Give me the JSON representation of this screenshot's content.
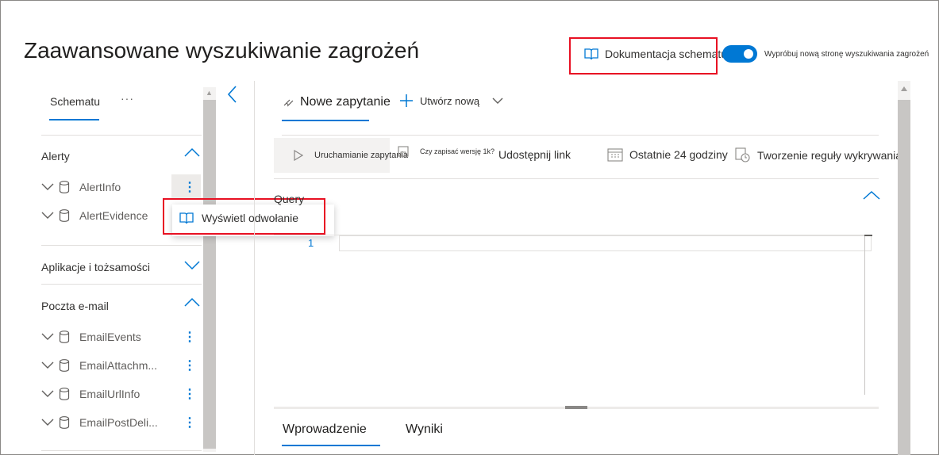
{
  "header": {
    "title": "Zaawansowane wyszukiwanie zagrożeń",
    "doc_link": "Dokumentacja schematu",
    "toggle_label": "Wypróbuj nową stronę wyszukiwania zagrożeń",
    "toggle_on": true
  },
  "schema": {
    "tab_label": "Schematu",
    "more_label": "···",
    "sections": [
      {
        "title": "Alerty",
        "expanded": true,
        "items": [
          "AlertInfo",
          "AlertEvidence"
        ]
      },
      {
        "title": "Aplikacje i tożsamości",
        "expanded": false,
        "items": []
      },
      {
        "title": "Poczta e-mail",
        "expanded": true,
        "items": [
          "EmailEvents",
          "EmailAttachm...",
          "EmailUrlInfo",
          "EmailPostDeli..."
        ]
      }
    ],
    "context_menu": {
      "item": "Wyświetl odwołanie"
    }
  },
  "query": {
    "tab_label": "Nowe zapytanie",
    "new_label": "Utwórz nową",
    "toolbar": {
      "run": "Uruchamianie zapytania",
      "save": "Czy zapisać wersję 1k?",
      "share": "Udostępnij link",
      "time": "Ostatnie 24 godziny",
      "rule": "Tworzenie reguły wykrywania"
    },
    "editor_label": "Query",
    "line_number": "1"
  },
  "bottom_tabs": [
    "Wprowadzenie",
    "Wyniki"
  ],
  "colors": {
    "accent": "#0078d4",
    "highlight_box": "#e81123"
  }
}
